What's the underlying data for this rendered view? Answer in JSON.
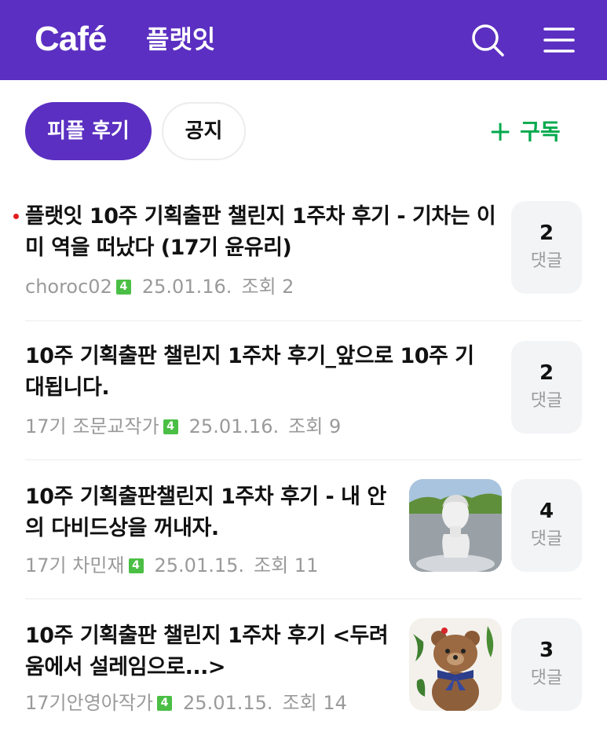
{
  "header": {
    "logo": "Café",
    "cafe_name": "플랫잇",
    "icons": [
      "search-icon",
      "hamburger-menu-icon"
    ],
    "color": "#5b2fc1"
  },
  "tabs": [
    {
      "label": "피플 후기",
      "active": true
    },
    {
      "label": "공지",
      "active": false
    }
  ],
  "subscribe": {
    "plus": "+",
    "label": "구독",
    "color": "#03a94d"
  },
  "posts": [
    {
      "title": "플랫잇 10주 기획출판 챌린지 1주차 후기 - 기차는 이미 역을 떠났다 (17기 윤유리)",
      "unread": true,
      "author": "choroc02",
      "level": "4",
      "date": "25.01.16.",
      "views": "조회 2",
      "comments": "2",
      "comment_label": "댓글"
    },
    {
      "title": "10주 기획출판 챌린지 1주차 후기_앞으로 10주 기대됩니다.",
      "unread": false,
      "author": "17기 조문교작가",
      "level": "4",
      "date": "25.01.16.",
      "views": "조회 9",
      "comments": "2",
      "comment_label": "댓글"
    },
    {
      "title": "10주 기획출판챌린지 1주차 후기 - 내 안의 다비드상을 꺼내자.",
      "unread": false,
      "author": "17기 차민재",
      "level": "4",
      "date": "25.01.15.",
      "views": "조회 11",
      "comments": "4",
      "comment_label": "댓글",
      "thumbnail": "david-statue-thumbnail"
    },
    {
      "title": "10주 기획출판 챌린지 1주차 후기 <두려움에서 설레임으로...>",
      "unread": false,
      "author": "17기안영아작가",
      "level": "4",
      "date": "25.01.15.",
      "views": "조회 14",
      "comments": "3",
      "comment_label": "댓글",
      "thumbnail": "teddy-bear-thumbnail"
    }
  ]
}
